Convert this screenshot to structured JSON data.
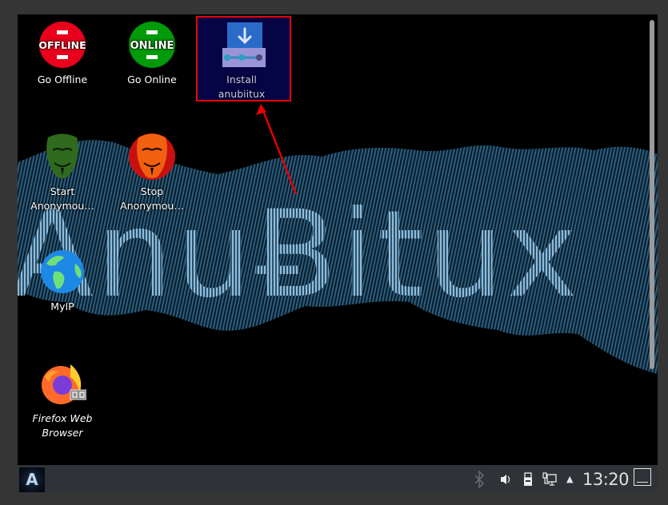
{
  "desktop": {
    "wallpaper_text": "AnuɃitux",
    "icons": [
      {
        "id": "go-offline",
        "label": "Go Offline",
        "glyph_text": "OFFLINE",
        "color": "#e8001c"
      },
      {
        "id": "go-online",
        "label": "Go Online",
        "glyph_text": "ONLINE",
        "color": "#009a0a"
      },
      {
        "id": "install-anubiitux",
        "label": "Install anubiitux",
        "selected": true
      },
      {
        "id": "start-anonymous",
        "label_line1": "Start",
        "label_line2": "Anonymou…",
        "color": "#2f6a1e"
      },
      {
        "id": "stop-anonymous",
        "label_line1": "Stop",
        "label_line2": "Anonymou…",
        "color": "#e84b10"
      },
      {
        "id": "myip",
        "label": "MyIP"
      },
      {
        "id": "firefox",
        "label_line1": "Firefox Web",
        "label_line2": "Browser"
      }
    ],
    "annotation": {
      "highlight_color": "#e00000"
    }
  },
  "panel": {
    "launcher_glyph": "A",
    "tray": {
      "bluetooth": "bluetooth-icon",
      "volume": "volume-icon",
      "usb": "usb-device-icon",
      "network": "network-icon",
      "expand": "▲"
    },
    "clock": "13:20"
  }
}
